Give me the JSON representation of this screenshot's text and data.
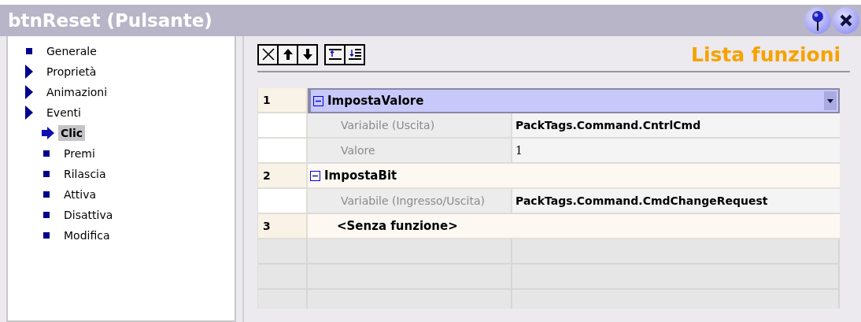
{
  "window": {
    "title": "btnReset (Pulsante)"
  },
  "tree": [
    {
      "label": "Generale",
      "kind": "leaf",
      "selected": false
    },
    {
      "label": "Proprietà",
      "kind": "group",
      "selected": false
    },
    {
      "label": "Animazioni",
      "kind": "group",
      "selected": false
    },
    {
      "label": "Eventi",
      "kind": "group",
      "selected": false,
      "children": [
        {
          "label": "Clic",
          "selected": true
        },
        {
          "label": "Premi",
          "selected": false
        },
        {
          "label": "Rilascia",
          "selected": false
        },
        {
          "label": "Attiva",
          "selected": false
        },
        {
          "label": "Disattiva",
          "selected": false
        },
        {
          "label": "Modifica",
          "selected": false
        }
      ]
    }
  ],
  "panel_title": "Lista funzioni",
  "functions": [
    {
      "number": "1",
      "name": "ImpostaValore",
      "kind": "function",
      "expanded": true,
      "selected": true,
      "params": [
        {
          "label": "Variabile (Uscita)",
          "value": "PackTags.Command.CntrlCmd",
          "bold": true
        },
        {
          "label": "Valore",
          "value": "1",
          "bold": false
        }
      ]
    },
    {
      "number": "2",
      "name": "ImpostaBit",
      "kind": "function",
      "expanded": true,
      "selected": false,
      "params": [
        {
          "label": "Variabile (Ingresso/Uscita)",
          "value": "PackTags.Command.CmdChangeRequest",
          "bold": true
        }
      ]
    },
    {
      "number": "3",
      "name": "<Senza funzione>",
      "kind": "placeholder",
      "selected": false
    }
  ]
}
